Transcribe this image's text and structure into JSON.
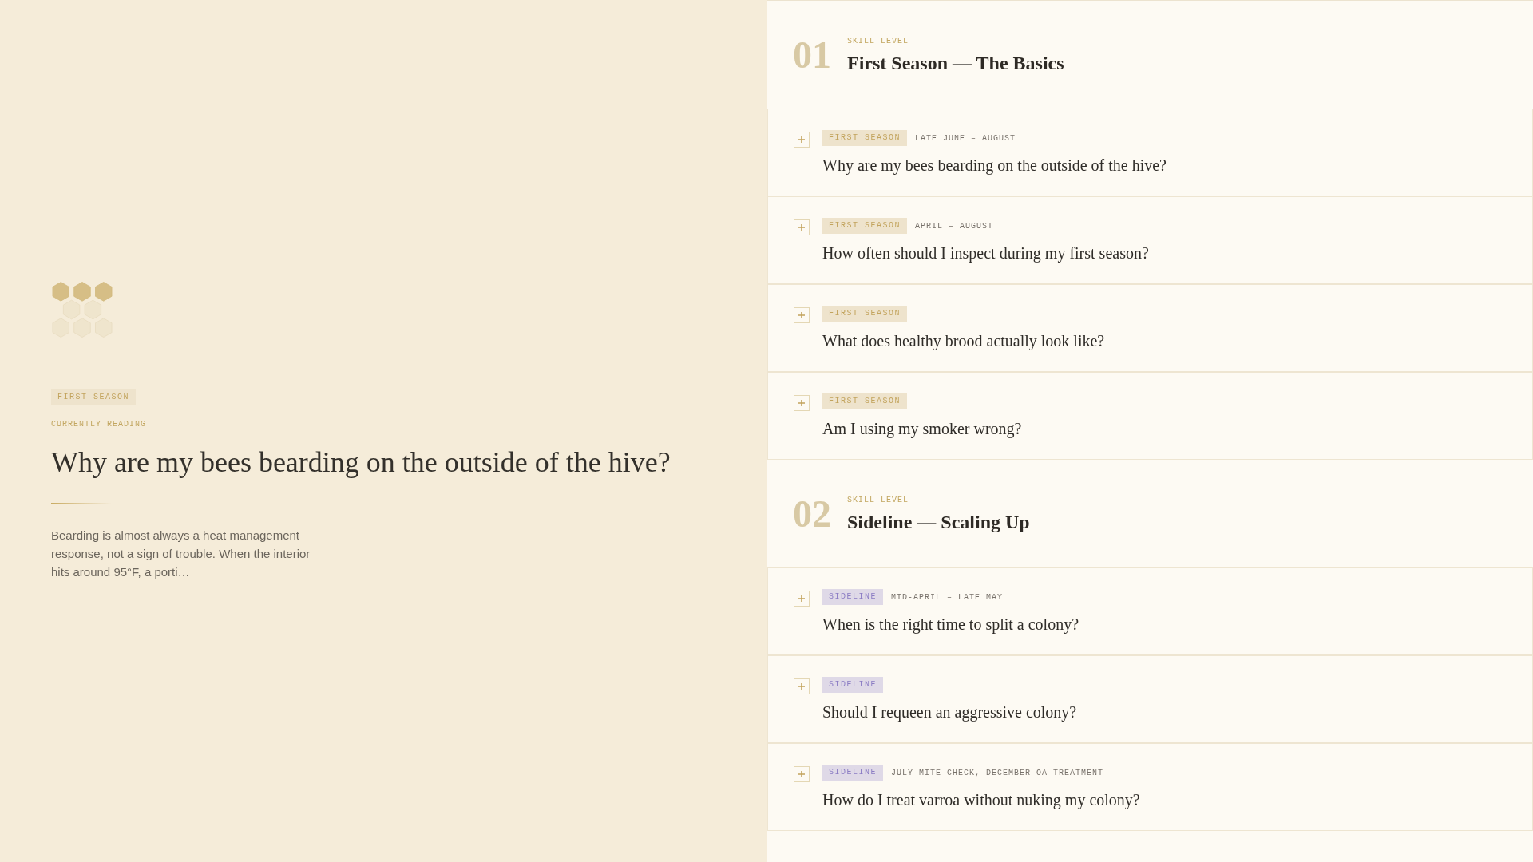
{
  "reading": {
    "tag": {
      "label": "FIRST SEASON",
      "color": "#c2a35c"
    },
    "eyebrow": "CURRENTLY READING",
    "title": "Why are my bees bearding on the outside of the hive?",
    "excerpt": "Bearding is almost always a heat management response, not a sign of trouble. When the interior hits around 95°F, a porti…"
  },
  "sections": [
    {
      "number": "01",
      "eyebrow": "SKILL LEVEL",
      "title": "First Season — The Basics",
      "questions": [
        {
          "tag": {
            "label": "FIRST SEASON",
            "color": "#c2a35c"
          },
          "timing": "LATE JUNE – AUGUST",
          "question": "Why are my bees bearding on the outside of the hive?",
          "expanded": false
        },
        {
          "tag": {
            "label": "FIRST SEASON",
            "color": "#c2a35c"
          },
          "timing": "APRIL – AUGUST",
          "question": "How often should I inspect during my first season?",
          "expanded": false
        },
        {
          "tag": {
            "label": "FIRST SEASON",
            "color": "#c2a35c"
          },
          "question": "What does healthy brood actually look like?",
          "expanded": false
        },
        {
          "tag": {
            "label": "FIRST SEASON",
            "color": "#c2a35c"
          },
          "question": "Am I using my smoker wrong?",
          "expanded": false
        }
      ]
    },
    {
      "number": "02",
      "eyebrow": "SKILL LEVEL",
      "title": "Sideline — Scaling Up",
      "questions": [
        {
          "tag": {
            "label": "SIDELINE",
            "color": "#8b7cc4"
          },
          "timing": "MID-APRIL – LATE MAY",
          "question": "When is the right time to split a colony?",
          "expanded": false
        },
        {
          "tag": {
            "label": "SIDELINE",
            "color": "#8b7cc4"
          },
          "question": "Should I requeen an aggressive colony?",
          "expanded": false
        },
        {
          "tag": {
            "label": "SIDELINE",
            "color": "#8b7cc4"
          },
          "timing": "JULY MITE CHECK, DECEMBER OA TREATMENT",
          "question": "How do I treat varroa without nuking my colony?",
          "expanded": false
        }
      ]
    }
  ]
}
